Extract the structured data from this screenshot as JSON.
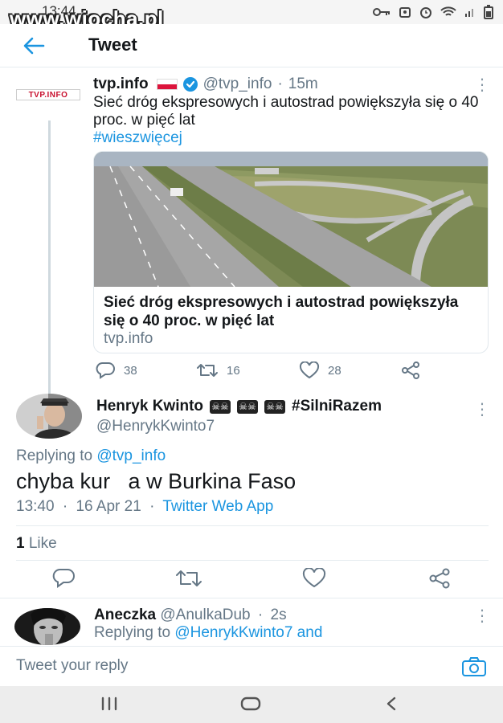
{
  "status_bar": {
    "time": "13:44",
    "watermark": "www.wiocha.pl"
  },
  "header": {
    "title": "Tweet"
  },
  "tweet1": {
    "logo_text": "TVP.INFO",
    "name": "tvp.info",
    "handle": "@tvp_info",
    "time": "15m",
    "separator": "·",
    "text": "Sieć dróg ekspresowych i autostrad powiększyła się o 40 proc. w pięć lat",
    "hashtag": "#wieszwięcej",
    "card": {
      "title": "Sieć dróg ekspresowych i autostrad powiększyła się o 40 proc. w pięć lat",
      "domain": "tvp.info"
    },
    "replies": "38",
    "retweets": "16",
    "likes": "28"
  },
  "tweet2": {
    "name": "Henryk Kwinto",
    "hashtag": "#SilniRazem",
    "handle": "@HenrykKwinto7",
    "replying_prefix": "Replying to",
    "replying_to": "@tvp_info",
    "text": "chyba kur   a w Burkina Faso",
    "time": "13:40",
    "date": "16 Apr 21",
    "separator": "·",
    "source": "Twitter Web App",
    "like_count": "1",
    "like_label": "Like"
  },
  "tweet3": {
    "name": "Aneczka",
    "handle": "@AnulkaDub",
    "separator": "·",
    "time": "2s",
    "replying_prefix": "Replying to",
    "replying_to": "@HenrykKwinto7 and"
  },
  "composer": {
    "placeholder": "Tweet your reply"
  },
  "colors": {
    "accent": "#1b95e0",
    "text": "#14171a",
    "muted": "#657786"
  }
}
